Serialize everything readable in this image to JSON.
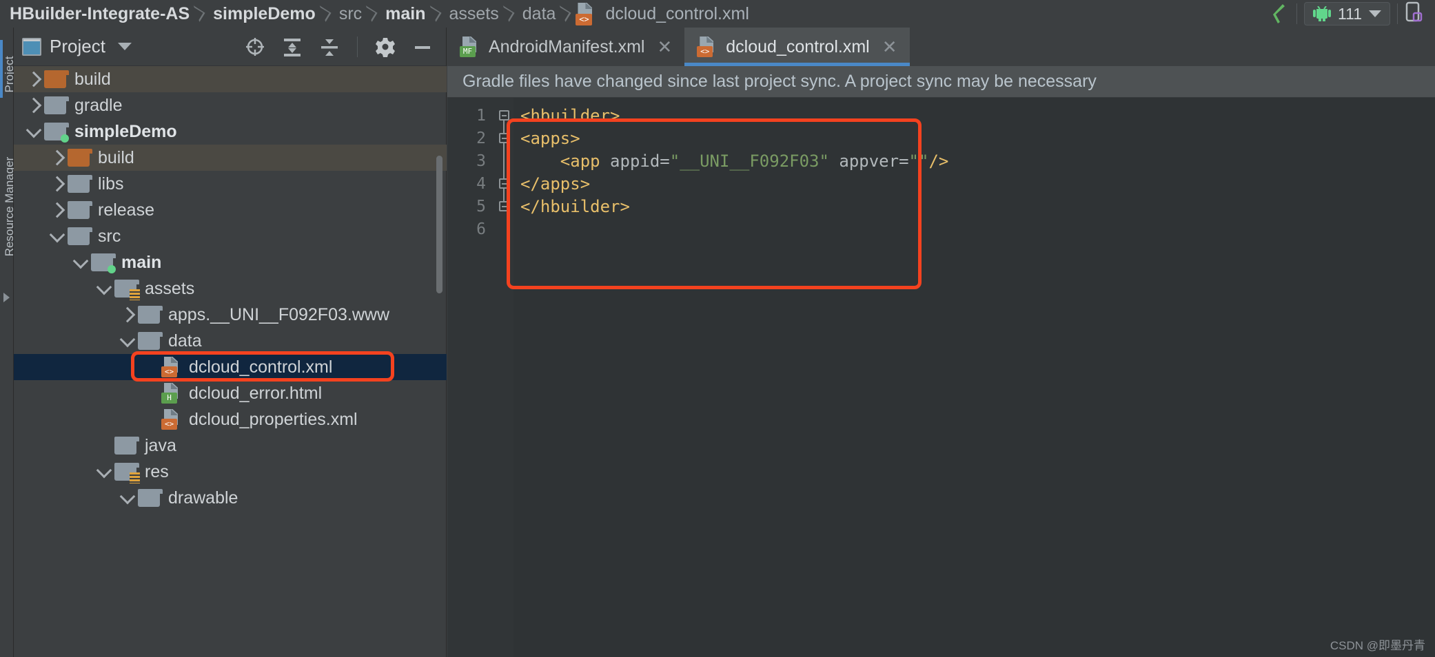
{
  "breadcrumb": {
    "items": [
      {
        "label": "HBuilder-Integrate-AS",
        "strong": true
      },
      {
        "label": "simpleDemo",
        "strong": true
      },
      {
        "label": "src",
        "strong": false
      },
      {
        "label": "main",
        "strong": true
      },
      {
        "label": "assets",
        "strong": false
      },
      {
        "label": "data",
        "strong": false
      },
      {
        "label": "dcloud_control.xml",
        "strong": false
      }
    ],
    "file_icon_badge": "<>"
  },
  "toolbar_right": {
    "build_icon": "hammer-icon",
    "device_name": "111",
    "device_icon": "android-robot-icon",
    "device_manager_icon": "device-manager-icon"
  },
  "tool_window_strip": {
    "project_label": "Project",
    "resource_manager_label": "Resource Manager"
  },
  "project_panel": {
    "title": "Project",
    "icons": [
      "locate-icon",
      "expand-all-icon",
      "collapse-all-icon",
      "settings-gear-icon",
      "hide-icon"
    ]
  },
  "tree": [
    {
      "label": "build",
      "indent": 0,
      "twisty": "right",
      "icon": "folder-orange",
      "excluded": true,
      "bold": false
    },
    {
      "label": "gradle",
      "indent": 0,
      "twisty": "right",
      "icon": "folder",
      "excluded": false,
      "bold": false
    },
    {
      "label": "simpleDemo",
      "indent": 0,
      "twisty": "down",
      "icon": "folder-module",
      "excluded": false,
      "bold": true
    },
    {
      "label": "build",
      "indent": 1,
      "twisty": "right",
      "icon": "folder-orange",
      "excluded": true,
      "bold": false
    },
    {
      "label": "libs",
      "indent": 1,
      "twisty": "right",
      "icon": "folder",
      "excluded": false,
      "bold": false
    },
    {
      "label": "release",
      "indent": 1,
      "twisty": "right",
      "icon": "folder",
      "excluded": false,
      "bold": false
    },
    {
      "label": "src",
      "indent": 1,
      "twisty": "down",
      "icon": "folder",
      "excluded": false,
      "bold": false
    },
    {
      "label": "main",
      "indent": 2,
      "twisty": "down",
      "icon": "folder-module",
      "excluded": false,
      "bold": true
    },
    {
      "label": "assets",
      "indent": 3,
      "twisty": "down",
      "icon": "folder-resource",
      "excluded": false,
      "bold": false
    },
    {
      "label": "apps.__UNI__F092F03.www",
      "indent": 4,
      "twisty": "right",
      "icon": "folder",
      "excluded": false,
      "bold": false
    },
    {
      "label": "data",
      "indent": 4,
      "twisty": "down",
      "icon": "folder",
      "excluded": false,
      "bold": false
    },
    {
      "label": "dcloud_control.xml",
      "indent": 5,
      "twisty": "none",
      "icon": "file-xml",
      "excluded": false,
      "bold": false,
      "selected": true,
      "highlighted": true
    },
    {
      "label": "dcloud_error.html",
      "indent": 5,
      "twisty": "none",
      "icon": "file-html",
      "excluded": false,
      "bold": false
    },
    {
      "label": "dcloud_properties.xml",
      "indent": 5,
      "twisty": "none",
      "icon": "file-xml",
      "excluded": false,
      "bold": false
    },
    {
      "label": "java",
      "indent": 3,
      "twisty": "none",
      "icon": "folder",
      "excluded": false,
      "bold": false
    },
    {
      "label": "res",
      "indent": 3,
      "twisty": "down",
      "icon": "folder-resource",
      "excluded": false,
      "bold": false
    },
    {
      "label": "drawable",
      "indent": 4,
      "twisty": "down",
      "icon": "folder",
      "excluded": false,
      "bold": false
    }
  ],
  "editor": {
    "tabs": [
      {
        "label": "AndroidManifest.xml",
        "badge": "MF",
        "badge_color": "#5b9e4e",
        "active": false
      },
      {
        "label": "dcloud_control.xml",
        "badge": "<>",
        "badge_color": "#cc6b33",
        "active": true
      }
    ],
    "notification": "Gradle files have changed since last project sync. A project sync may be necessary",
    "line_numbers": [
      "1",
      "2",
      "3",
      "4",
      "5",
      "6"
    ],
    "code_lines": [
      {
        "indent": "",
        "parts": [
          {
            "t": "<hbuilder>",
            "c": "tag"
          }
        ]
      },
      {
        "indent": "",
        "parts": [
          {
            "t": "<apps>",
            "c": "tag"
          }
        ]
      },
      {
        "indent": "    ",
        "parts": [
          {
            "t": "<app ",
            "c": "tag"
          },
          {
            "t": "appid=",
            "c": "attr"
          },
          {
            "t": "\"__UNI__F092F03\"",
            "c": "val"
          },
          {
            "t": " appver=",
            "c": "attr"
          },
          {
            "t": "\"\"",
            "c": "val"
          },
          {
            "t": "/>",
            "c": "tag"
          }
        ]
      },
      {
        "indent": "",
        "parts": [
          {
            "t": "</apps>",
            "c": "tag"
          }
        ]
      },
      {
        "indent": "",
        "parts": [
          {
            "t": "</hbuilder>",
            "c": "tag"
          }
        ]
      },
      {
        "indent": "",
        "parts": []
      }
    ]
  },
  "watermark": "CSDN @即墨丹青",
  "colors": {
    "accent_blue": "#4a88c7",
    "annotation_red": "#f4421f",
    "selection_navy": "#10263f",
    "excluded_folder": "#b5672f",
    "tag_orange": "#e8bf6a",
    "value_green": "#7a9b63"
  }
}
